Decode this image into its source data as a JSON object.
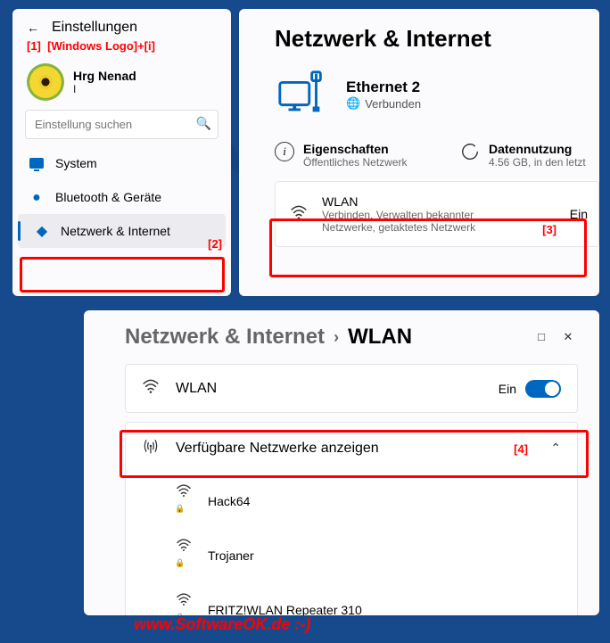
{
  "sidebar": {
    "back_title": "Einstellungen",
    "annotation1_num": "[1]",
    "annotation1_txt": "[Windows Logo]+[i]",
    "user_name": "Hrg Nenad",
    "user_sub": "I",
    "search_placeholder": "Einstellung suchen",
    "items": [
      {
        "label": "System"
      },
      {
        "label": "Bluetooth & Geräte"
      },
      {
        "label": "Netzwerk & Internet"
      }
    ],
    "annotation2": "[2]"
  },
  "main": {
    "title": "Netzwerk & Internet",
    "eth_name": "Ethernet 2",
    "eth_status": "Verbunden",
    "props_label": "Eigenschaften",
    "props_sub": "Öffentliches Netzwerk",
    "data_label": "Datennutzung",
    "data_sub": "4.56 GB, in den letzt",
    "wlan_card": {
      "title": "WLAN",
      "sub": "Verbinden, Verwalten bekannter Netzwerke, getaktetes Netzwerk",
      "toggle": "Ein"
    },
    "annotation3": "[3]"
  },
  "wlan": {
    "bc_parent": "Netzwerk & Internet",
    "bc_current": "WLAN",
    "card_title": "WLAN",
    "card_toggle": "Ein",
    "avail_label": "Verfügbare Netzwerke anzeigen",
    "annotation4": "[4]",
    "networks": [
      {
        "name": "Hack64"
      },
      {
        "name": "Trojaner"
      },
      {
        "name": "FRITZ!WLAN Repeater 310"
      }
    ]
  },
  "footer": "www.SoftwareOK.de :-)",
  "watermark": "SoftwareOK.de"
}
